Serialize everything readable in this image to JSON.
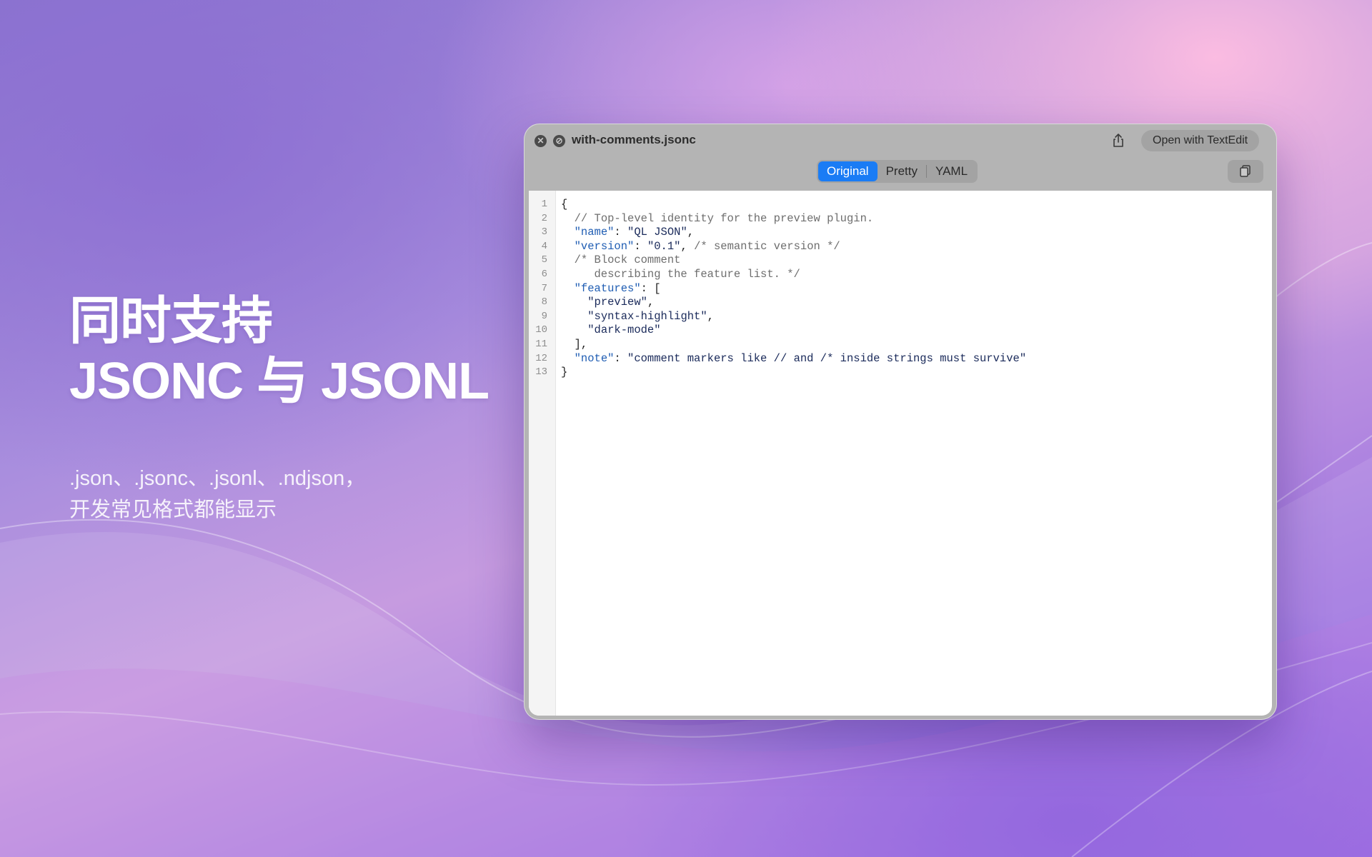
{
  "hero": {
    "title_line1": "同时支持",
    "title_line2": "JSONC 与 JSONL",
    "sub_line1": ".json、.jsonc、.jsonl、.ndjson，",
    "sub_line2": "开发常见格式都能显示"
  },
  "window": {
    "title": "with-comments.jsonc",
    "open_button": "Open with TextEdit",
    "tabs": [
      {
        "label": "Original",
        "active": true
      },
      {
        "label": "Pretty",
        "active": false
      },
      {
        "label": "YAML",
        "active": false
      }
    ],
    "icons": [
      "close-icon",
      "block-icon",
      "share-icon",
      "copy-icon"
    ]
  },
  "code": [
    {
      "n": "1",
      "parts": [
        [
          "p",
          "{"
        ]
      ]
    },
    {
      "n": "2",
      "parts": [
        [
          "p",
          "  "
        ],
        [
          "c",
          "// Top-level identity for the preview plugin."
        ]
      ]
    },
    {
      "n": "3",
      "parts": [
        [
          "p",
          "  "
        ],
        [
          "k",
          "\"name\""
        ],
        [
          "p",
          ": "
        ],
        [
          "s",
          "\"QL JSON\""
        ],
        [
          "p",
          ","
        ]
      ]
    },
    {
      "n": "4",
      "parts": [
        [
          "p",
          "  "
        ],
        [
          "k",
          "\"version\""
        ],
        [
          "p",
          ": "
        ],
        [
          "s",
          "\"0.1\""
        ],
        [
          "p",
          ", "
        ],
        [
          "c",
          "/* semantic version */"
        ]
      ]
    },
    {
      "n": "5",
      "parts": [
        [
          "p",
          "  "
        ],
        [
          "c",
          "/* Block comment"
        ]
      ]
    },
    {
      "n": "6",
      "parts": [
        [
          "c",
          "     describing the feature list. */"
        ]
      ]
    },
    {
      "n": "7",
      "parts": [
        [
          "p",
          "  "
        ],
        [
          "k",
          "\"features\""
        ],
        [
          "p",
          ": ["
        ]
      ]
    },
    {
      "n": "8",
      "parts": [
        [
          "p",
          "    "
        ],
        [
          "s",
          "\"preview\""
        ],
        [
          "p",
          ","
        ]
      ]
    },
    {
      "n": "9",
      "parts": [
        [
          "p",
          "    "
        ],
        [
          "s",
          "\"syntax-highlight\""
        ],
        [
          "p",
          ","
        ]
      ]
    },
    {
      "n": "10",
      "parts": [
        [
          "p",
          "    "
        ],
        [
          "s",
          "\"dark-mode\""
        ]
      ]
    },
    {
      "n": "11",
      "parts": [
        [
          "p",
          "  ],"
        ]
      ]
    },
    {
      "n": "12",
      "parts": [
        [
          "p",
          "  "
        ],
        [
          "k",
          "\"note\""
        ],
        [
          "p",
          ": "
        ],
        [
          "s",
          "\"comment markers like // and /* inside strings must survive\""
        ]
      ]
    },
    {
      "n": "13",
      "parts": [
        [
          "p",
          "}"
        ]
      ]
    }
  ],
  "colors": {
    "accent": "#1a7cf5",
    "key": "#1f5db3",
    "string": "#1a2a5a",
    "comment": "#6e6e6e"
  }
}
